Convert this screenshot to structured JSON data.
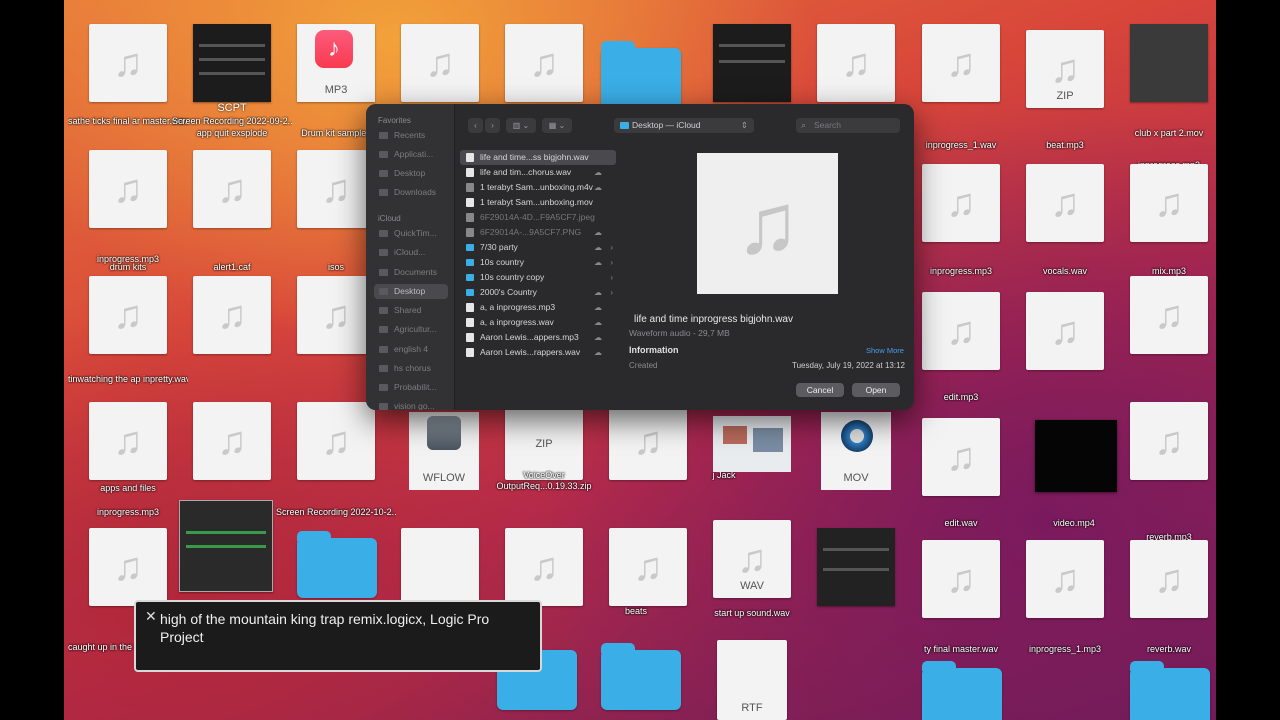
{
  "dialog": {
    "sidebar": {
      "favorites_header": "Favorites",
      "favorites": [
        "Recents",
        "Applicati...",
        "Desktop",
        "Downloads"
      ],
      "icloud_header": "iCloud",
      "icloud": [
        "QuickTim...",
        "iCloud...",
        "Documents",
        "Desktop",
        "Shared",
        "Agricultur...",
        "english 4",
        "hs chorus",
        "Probabilit...",
        "vision go..."
      ]
    },
    "toolbar": {
      "back": "‹",
      "forward": "›",
      "view_columns": "▥ ⌄",
      "view_grid": "▦ ⌄"
    },
    "location": "Desktop — iCloud",
    "search_placeholder": "Search",
    "files": [
      {
        "name": "life and time...ss bigjohn.wav",
        "kind": "doc",
        "selected": true
      },
      {
        "name": "life and tim...chorus.wav",
        "kind": "doc",
        "cloud": "☁"
      },
      {
        "name": "1 terabyt Sam...unboxing.m4v",
        "kind": "img",
        "cloud": "☁"
      },
      {
        "name": "1 terabyt Sam...unboxing.mov",
        "kind": "doc"
      },
      {
        "name": "6F29014A-4D...F9A5CF7.jpeg",
        "kind": "img",
        "dim": true
      },
      {
        "name": "6F29014A-...9A5CF7.PNG",
        "kind": "img",
        "dim": true,
        "cloud": "☁"
      },
      {
        "name": "7/30 party",
        "kind": "folder",
        "cloud": "☁",
        "arrow": "›"
      },
      {
        "name": "10s country",
        "kind": "folder",
        "cloud": "☁",
        "arrow": "›"
      },
      {
        "name": "10s country copy",
        "kind": "folder",
        "arrow": "›"
      },
      {
        "name": "2000's Country",
        "kind": "folder",
        "cloud": "☁",
        "arrow": "›"
      },
      {
        "name": "a, a inprogress.mp3",
        "kind": "doc",
        "cloud": "☁"
      },
      {
        "name": "a, a inprogress.wav",
        "kind": "doc",
        "cloud": "☁"
      },
      {
        "name": "Aaron Lewis...appers.mp3",
        "kind": "doc",
        "cloud": "☁"
      },
      {
        "name": "Aaron Lewis...rappers.wav",
        "kind": "doc",
        "cloud": "☁"
      }
    ],
    "preview": {
      "filename": "life and time inprogress bigjohn.wav",
      "kind": "Waveform audio - 29,7 MB",
      "info_header": "Information",
      "show_more": "Show More",
      "created_label": "Created",
      "created_value": "Tuesday, July 19, 2022 at 13:12"
    },
    "cancel": "Cancel",
    "open": "Open"
  },
  "tooltip": {
    "close": "✕",
    "text": "high of the mountain king trap remix.logicx, Logic Pro Project"
  },
  "desktop": {
    "note_glyph": "♫",
    "badges": {
      "scpt": "SCPT",
      "mp3": "MP3",
      "zip1": "ZIP",
      "zip2": "ZIP",
      "wflow": "WFLOW",
      "mov": "MOV",
      "wav": "WAV",
      "rtf": "RTF"
    },
    "labels": [
      "sathe ticks final ar master.wav",
      "Screen Recording 2022-09-2...AM.mov",
      "app quit exsplode",
      "Drum kit samples",
      "inprogress_1.wav",
      "beat.mp3",
      "club x part 2.mov",
      "inprogress.mp3",
      "inprogress.mp3",
      "alert1.caf",
      "isos",
      "inprogress.mp3",
      "vocals.wav",
      "mix.mp3",
      "drum kits",
      "tinwatching the ap inpretty.wav",
      "edit.mp3",
      "reverb.mp3",
      "apps and files",
      "inprogress.mp3",
      "Screen Recording 2022-10-2...PM.mov",
      "OutputReq...0.19.33.zip",
      "VoiceOver",
      "j Jack",
      "edit.wav",
      "video.mp4",
      "caught up in the inprogress bro",
      "beats",
      "start up sound.wav",
      "ty final master.wav",
      "inprogress_1.mp3",
      "reverb.wav"
    ]
  }
}
